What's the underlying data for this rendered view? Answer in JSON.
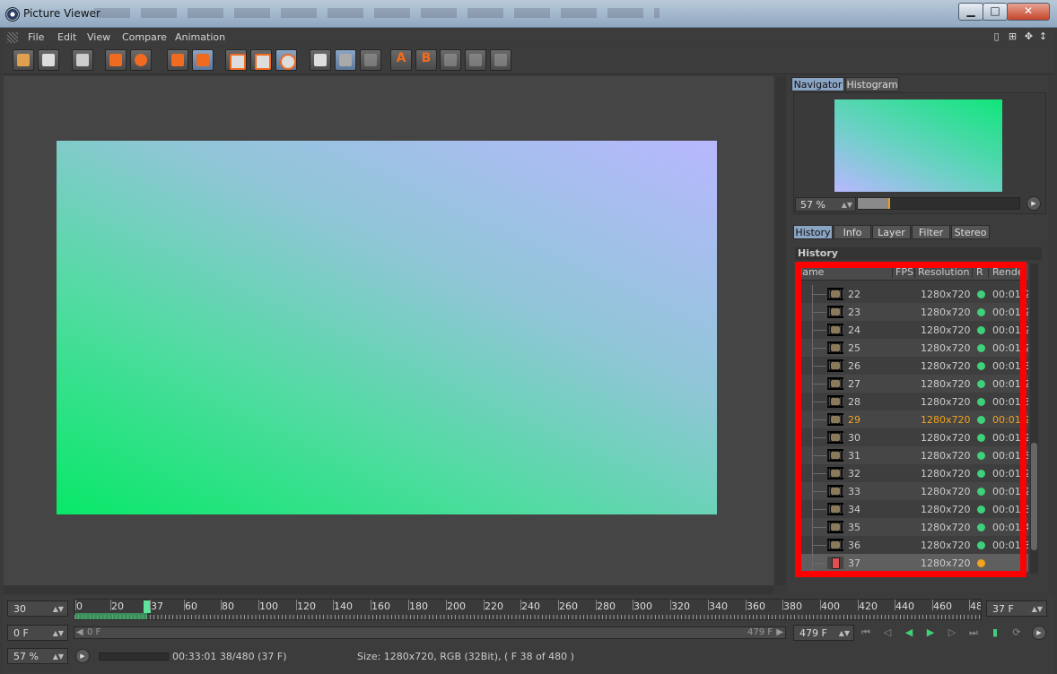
{
  "window": {
    "title": "Picture Viewer"
  },
  "menu": [
    "File",
    "Edit",
    "View",
    "Compare",
    "Animation"
  ],
  "toolbar": {
    "icons": [
      "open-icon",
      "save-icon",
      "render-icon",
      "layer-down-icon",
      "user-down-icon",
      "delete-icon",
      "copy-icon",
      "view-a-icon",
      "view-b-icon",
      "view-ab-icon",
      "ab-split-icon",
      "ab-swap-icon",
      "ab-disabled-icon",
      "compare-a-icon",
      "compare-b-icon",
      "compare-1-icon",
      "compare-2-icon",
      "compare-3-icon"
    ],
    "compare_a": "A",
    "compare_b": "B"
  },
  "navigator": {
    "tabs": [
      "Navigator",
      "Histogram"
    ],
    "active_tab": "Navigator",
    "zoom": "57 %",
    "zoom_fraction": 0.19
  },
  "panel_tabs": [
    "History",
    "Info",
    "Layer",
    "Filter",
    "Stereo"
  ],
  "history": {
    "title": "History",
    "columns": {
      "name": "Name",
      "fps": "FPS",
      "resolution": "Resolution",
      "r": "R",
      "render": "Rende"
    },
    "rows": [
      {
        "frame": "22",
        "res": "1280x720",
        "time": "00:01:2",
        "status": "done"
      },
      {
        "frame": "23",
        "res": "1280x720",
        "time": "00:01:2",
        "status": "done"
      },
      {
        "frame": "24",
        "res": "1280x720",
        "time": "00:01:2",
        "status": "done"
      },
      {
        "frame": "25",
        "res": "1280x720",
        "time": "00:01:2",
        "status": "done"
      },
      {
        "frame": "26",
        "res": "1280x720",
        "time": "00:01:3",
        "status": "done"
      },
      {
        "frame": "27",
        "res": "1280x720",
        "time": "00:01:2",
        "status": "done"
      },
      {
        "frame": "28",
        "res": "1280x720",
        "time": "00:01:3",
        "status": "done"
      },
      {
        "frame": "29",
        "res": "1280x720",
        "time": "00:01:2",
        "status": "done",
        "highlight": true
      },
      {
        "frame": "30",
        "res": "1280x720",
        "time": "00:01:2",
        "status": "done"
      },
      {
        "frame": "31",
        "res": "1280x720",
        "time": "00:01:3",
        "status": "done"
      },
      {
        "frame": "32",
        "res": "1280x720",
        "time": "00:01:2",
        "status": "done"
      },
      {
        "frame": "33",
        "res": "1280x720",
        "time": "00:01:2",
        "status": "done"
      },
      {
        "frame": "34",
        "res": "1280x720",
        "time": "00:01:3",
        "status": "done"
      },
      {
        "frame": "35",
        "res": "1280x720",
        "time": "00:01:4",
        "status": "done"
      },
      {
        "frame": "36",
        "res": "1280x720",
        "time": "00:01:3",
        "status": "done"
      },
      {
        "frame": "37",
        "res": "1280x720",
        "time": "",
        "status": "rendering",
        "current": true
      }
    ],
    "colors": {
      "done": "#3fd07a",
      "rendering": "#f3a21c",
      "highlight": "#f3a21c",
      "annotation": "#ff0000"
    }
  },
  "timeline": {
    "fps": "30",
    "ticks": [
      "0",
      "20",
      "37",
      "60",
      "80",
      "100",
      "120",
      "140",
      "160",
      "180",
      "200",
      "220",
      "240",
      "260",
      "280",
      "300",
      "320",
      "340",
      "360",
      "380",
      "400",
      "420",
      "440",
      "460",
      "48"
    ],
    "current_frame": "37 F",
    "start_field": "0 F",
    "scrub_start": "0 F",
    "scrub_end": "479 F",
    "end_field": "479 F"
  },
  "status": {
    "zoom": "57 %",
    "time": "00:33:01 38/480 (37 F)",
    "info": "Size: 1280x720, RGB (32Bit),  ( F 38 of 480 )"
  }
}
